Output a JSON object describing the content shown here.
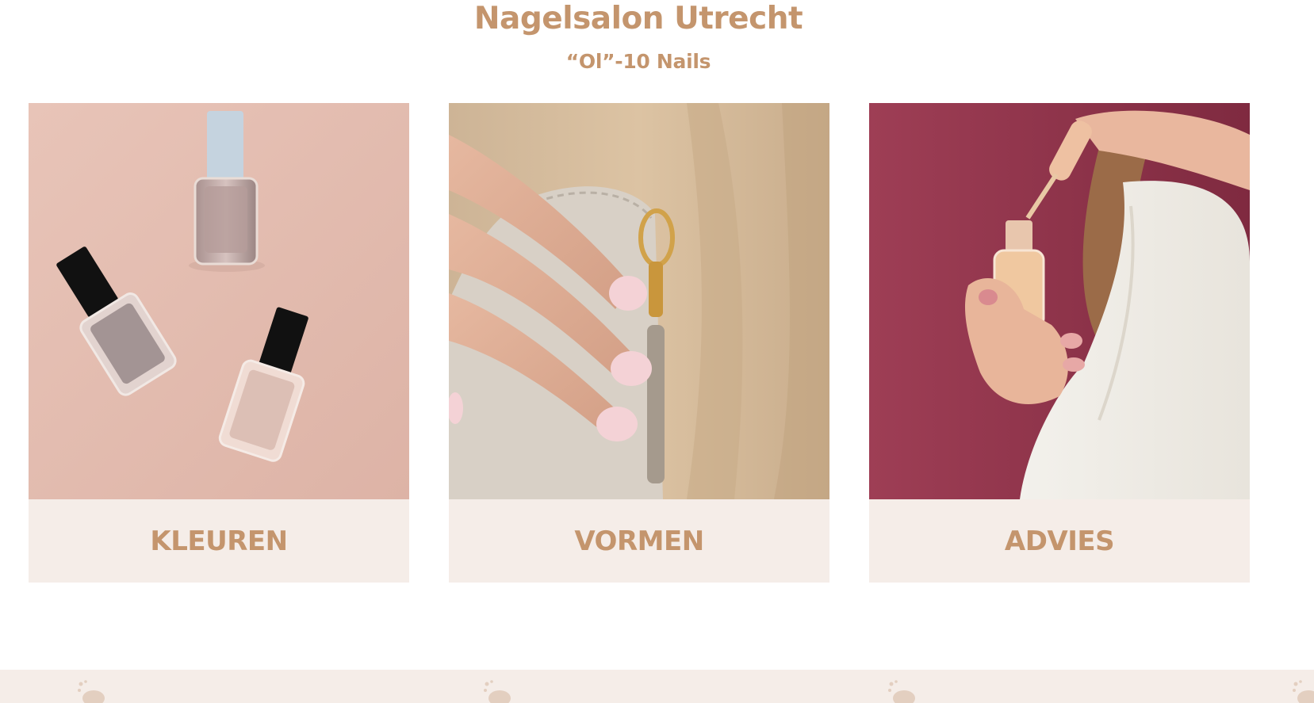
{
  "header": {
    "title": "Nagelsalon Utrecht",
    "subtitle": "“Ol”-10 Nails"
  },
  "cards": [
    {
      "label": "KLEUREN",
      "image": "nail-polish-bottles-photo"
    },
    {
      "label": "VORMEN",
      "image": "manicured-hand-photo"
    },
    {
      "label": "ADVIES",
      "image": "applying-polish-photo"
    }
  ],
  "colors": {
    "accent": "#c4956d",
    "card_label_bg": "#f5ede8",
    "footer_bg": "#f5ede8",
    "page_bg": "#ffffff"
  }
}
